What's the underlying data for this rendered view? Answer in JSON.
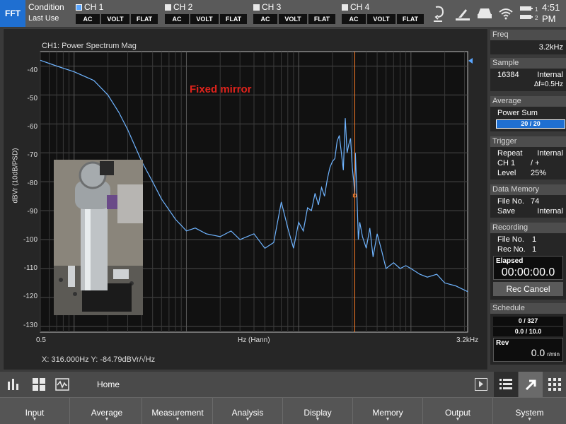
{
  "topbar": {
    "mode": "FFT",
    "condition_title": "Condition",
    "condition_sub": "Last Use",
    "channels": [
      {
        "name": "CH 1",
        "active": true,
        "coupling": "AC",
        "unit": "VOLT",
        "window": "FLAT"
      },
      {
        "name": "CH 2",
        "active": false,
        "coupling": "AC",
        "unit": "VOLT",
        "window": "FLAT"
      },
      {
        "name": "CH 3",
        "active": false,
        "coupling": "AC",
        "unit": "VOLT",
        "window": "FLAT"
      },
      {
        "name": "CH 4",
        "active": false,
        "coupling": "AC",
        "unit": "VOLT",
        "window": "FLAT"
      }
    ],
    "battery_labels": [
      "1",
      "2"
    ],
    "time_line1": "4:51",
    "time_line2": "PM",
    "icons": [
      "pen-undo-icon",
      "tilt-icon",
      "printer-icon",
      "wifi-icon",
      "battery-icon"
    ]
  },
  "graph": {
    "title": "CH1: Power Spectrum Mag",
    "ylabel": "dBVr (10dB/PSD)",
    "xlabel": "Hz (Hann)",
    "x_start": "0.5",
    "x_end": "3.2kHz",
    "cursor_readout": "X: 316.000Hz Y: -84.79dBVr/√Hz",
    "annotation": "Fixed mirror",
    "y_ticks": [
      "-40",
      "-50",
      "-60",
      "-70",
      "-80",
      "-90",
      "-100",
      "-110",
      "-120",
      "-130"
    ],
    "colors": {
      "trace": "#6fb4ff",
      "cursor": "#ff7f27",
      "annotation": "#e0231c"
    }
  },
  "chart_data": {
    "type": "line",
    "title": "CH1: Power Spectrum Mag",
    "xlabel": "Hz (Hann)",
    "ylabel": "dBVr (10dB/PSD)",
    "xscale": "log",
    "xlim": [
      0.5,
      3200
    ],
    "ylim": [
      -132,
      -35
    ],
    "grid": true,
    "cursor_x": 316,
    "cursor_y": -84.79,
    "series": [
      {
        "x": [
          0.5,
          0.7,
          1.0,
          1.5,
          2.0,
          2.5,
          3.0,
          4.0,
          5.0,
          6.0,
          8.0,
          10,
          12,
          15,
          20,
          25,
          30,
          40,
          50,
          60,
          70,
          80,
          90,
          100,
          110,
          120,
          130,
          140,
          150,
          160,
          170,
          180,
          190,
          200,
          210,
          220,
          230,
          240,
          250,
          260,
          270,
          280,
          290,
          300,
          310,
          316,
          320,
          330,
          340,
          350,
          370,
          400,
          430,
          460,
          500,
          550,
          600,
          700,
          800,
          900,
          1000,
          1200,
          1400,
          1700,
          2000,
          2500,
          3200
        ],
        "y": [
          -38,
          -40,
          -42,
          -45,
          -50,
          -56,
          -62,
          -73,
          -80,
          -86,
          -93,
          -97,
          -96,
          -98,
          -99,
          -97,
          -100,
          -98,
          -103,
          -101,
          -87,
          -96,
          -103,
          -94,
          -97,
          -89,
          -90,
          -84,
          -88,
          -82,
          -85,
          -79,
          -75,
          -73,
          -72,
          -66,
          -64,
          -70,
          -76,
          -58,
          -70,
          -67,
          -65,
          -75,
          -80,
          -84.79,
          -70,
          -84,
          -100,
          -94,
          -99,
          -103,
          -96,
          -106,
          -98,
          -104,
          -110,
          -108,
          -110,
          -109,
          -110,
          -112,
          -113,
          -112,
          -115,
          -116,
          -118
        ]
      }
    ]
  },
  "sidebar": {
    "freq": {
      "title": "Freq",
      "value": "3.2kHz"
    },
    "sample": {
      "title": "Sample",
      "points": "16384",
      "source": "Internal",
      "resolution": "∆f=0.5Hz"
    },
    "average": {
      "title": "Average",
      "mode": "Power Sum",
      "progress": "20 / 20",
      "progress_fraction": 1.0
    },
    "trigger": {
      "title": "Trigger",
      "k1": "Repeat",
      "v1": "Internal",
      "k2": "CH 1",
      "v2": "/  +",
      "k3": "Level",
      "v3": "25%"
    },
    "data_memory": {
      "title": "Data Memory",
      "k1": "File No.",
      "v1": "74",
      "k2": "Save",
      "v2": "Internal"
    },
    "recording": {
      "title": "Recording",
      "k1": "File No.",
      "v1": "1",
      "k2": "Rec No.",
      "v2": "1",
      "elapsed_label": "Elapsed",
      "elapsed_value": "00:00:00.0",
      "cancel_label": "Rec Cancel"
    },
    "schedule": {
      "title": "Schedule",
      "bar1": "0 / 327",
      "bar2": "0.0 / 10.0",
      "rev_label": "Rev",
      "rev_value": "0.0",
      "rev_unit": "r/min"
    }
  },
  "toolbar": {
    "home_label": "Home"
  },
  "menu": [
    "Input",
    "Average",
    "Measurement",
    "Analysis",
    "Display",
    "Memory",
    "Output",
    "System"
  ]
}
